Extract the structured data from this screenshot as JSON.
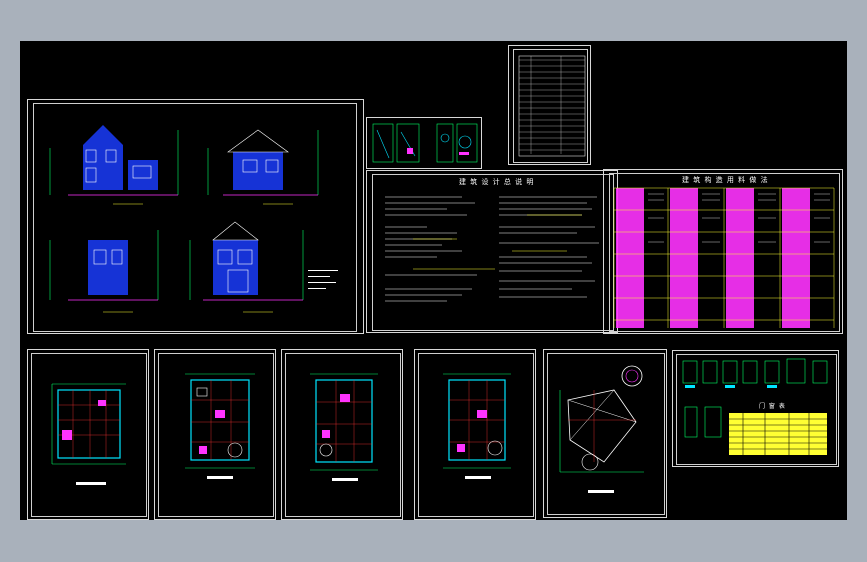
{
  "colors": {
    "background": "#a9b1bb",
    "canvas": "#000000",
    "frame": "#d8d8d8",
    "cyan": "#00e5ff",
    "green": "#00ff66",
    "yellow": "#ffff33",
    "magenta": "#ff33ff",
    "red": "#ff3333",
    "blue": "#3355ff",
    "white": "#ffffff"
  },
  "sheets": {
    "elevations": {
      "name": "elevations-sheet"
    },
    "details_small": {
      "name": "detail-sheet"
    },
    "drawing_list": {
      "name": "drawing-list-sheet"
    },
    "design_notes": {
      "name": "design-notes-sheet",
      "title": "建 筑 设 计 总 说 明"
    },
    "material_table": {
      "name": "material-table-sheet",
      "title": "建 筑 构 造 用 料 做 法"
    },
    "plans": [
      {
        "name": "plan-sheet-1"
      },
      {
        "name": "plan-sheet-2"
      },
      {
        "name": "plan-sheet-3"
      },
      {
        "name": "plan-sheet-4"
      },
      {
        "name": "roof-plan-sheet"
      }
    ],
    "door_window": {
      "name": "door-window-sheet",
      "title": "门 窗 表"
    }
  },
  "icons": [
    "elevation-drawing-icon",
    "floor-plan-drawing-icon",
    "table-icon"
  ]
}
